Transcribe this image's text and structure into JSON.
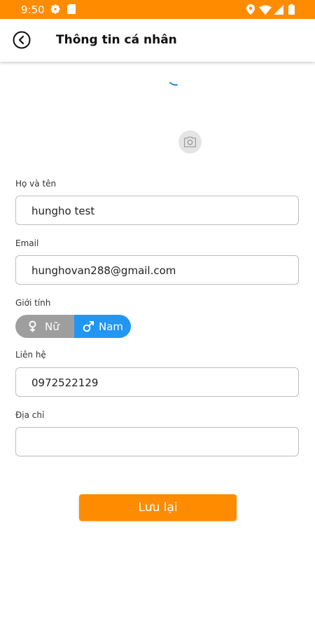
{
  "status_bar": {
    "time": "9:50"
  },
  "app_bar": {
    "title": "Thông tin cá nhân"
  },
  "form": {
    "name_label": "Họ và tên",
    "name_value": "hungho test",
    "email_label": "Email",
    "email_value": "hunghovan288@gmail.com",
    "gender_label": "Giới tính",
    "gender_female": "Nữ",
    "gender_male": "Nam",
    "gender_selected": "Nam",
    "contact_label": "Liên hệ",
    "contact_value": "0972522129",
    "address_label": "Địa chỉ",
    "address_value": ""
  },
  "save_button": "Lưu lại",
  "colors": {
    "accent": "#ff8c00",
    "gender_selected": "#2196f3",
    "gender_unselected": "#9e9e9e"
  },
  "icons": [
    "gear-icon",
    "sim-card-icon",
    "location-icon",
    "wifi-icon",
    "signal-icon",
    "battery-icon",
    "back-icon",
    "camera-icon",
    "female-icon",
    "male-icon"
  ]
}
